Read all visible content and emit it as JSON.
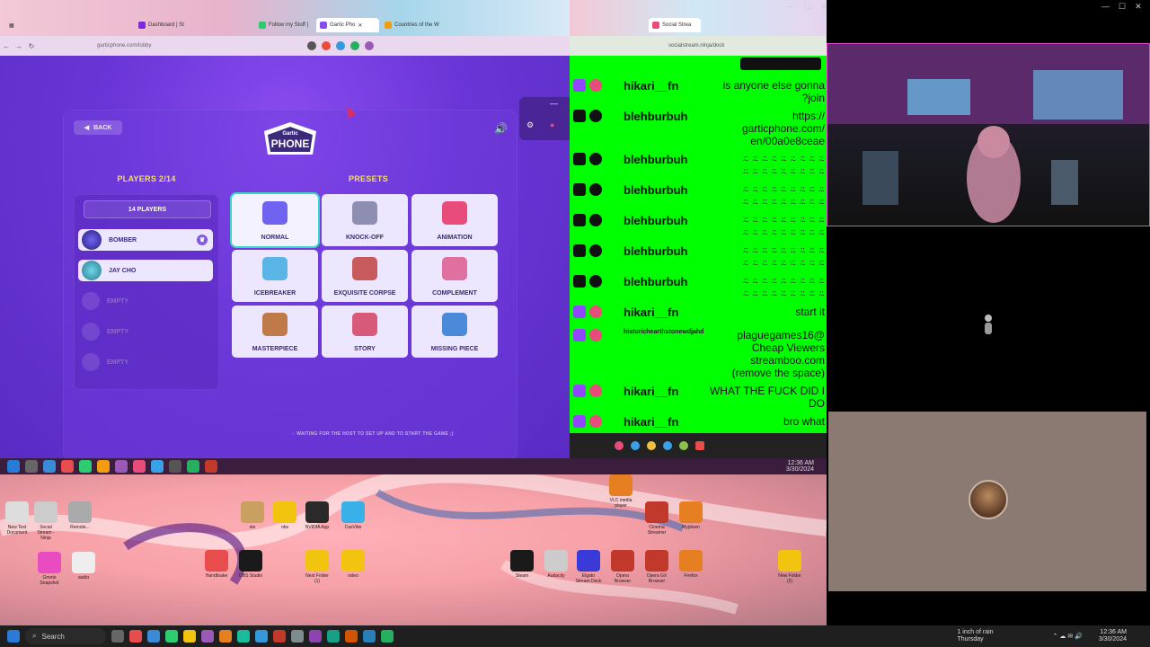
{
  "left_browser": {
    "tabs": [
      "Dashboard | St",
      "Follow my Stuff | ",
      "Gartic Pho",
      "Countries of the W"
    ],
    "url": "garticphone.com/lobby"
  },
  "gartic": {
    "back_label": "BACK",
    "players_title": "PLAYERS 2/14",
    "presets_title": "PRESETS",
    "players_count_label": "14 PLAYERS",
    "players": [
      {
        "name": "BOMBER",
        "filled": true
      },
      {
        "name": "JAY CHO",
        "filled": true
      },
      {
        "name": "EMPTY",
        "filled": false
      },
      {
        "name": "EMPTY",
        "filled": false
      },
      {
        "name": "EMPTY",
        "filled": false
      }
    ],
    "presets": [
      {
        "label": "NORMAL",
        "selected": true
      },
      {
        "label": "KNOCK-OFF",
        "selected": false
      },
      {
        "label": "ANIMATION",
        "selected": false
      },
      {
        "label": "ICEBREAKER",
        "selected": false
      },
      {
        "label": "EXQUISITE CORPSE",
        "selected": false
      },
      {
        "label": "COMPLEMENT",
        "selected": false
      },
      {
        "label": "MASTERPIECE",
        "selected": false
      },
      {
        "label": "STORY",
        "selected": false
      },
      {
        "label": "MISSING PIECE",
        "selected": false
      }
    ],
    "waiting_text": "WAITING FOR THE HOST TO SET UP AND TO START THE GAME ;)"
  },
  "chat_browser": {
    "tab": "Social Strea",
    "url": "socialstream.ninja/dock"
  },
  "chat": [
    {
      "user": "hikari__fn",
      "text": "is anyone else gonna\n?join",
      "platform": "twitch"
    },
    {
      "user": "blehburbuh",
      "text": "https://\ngarticphone.com/\nen/00a0e8ceae",
      "platform": "kick"
    },
    {
      "user": "blehburbuh",
      "text": "⍨ ⍨ ⍨ ⍨ ⍨ ⍨ ⍨ ⍨ ⍨\n⍨ ⍨ ⍨ ⍨ ⍨ ⍨ ⍨ ⍨ ⍨",
      "platform": "kick"
    },
    {
      "user": "blehburbuh",
      "text": "⍨ ⍨ ⍨ ⍨ ⍨ ⍨ ⍨ ⍨ ⍨\n⍨ ⍨ ⍨ ⍨ ⍨ ⍨ ⍨ ⍨ ⍨",
      "platform": "kick"
    },
    {
      "user": "blehburbuh",
      "text": "⍨ ⍨ ⍨ ⍨ ⍨ ⍨ ⍨ ⍨ ⍨\n⍨ ⍨ ⍨ ⍨ ⍨ ⍨ ⍨ ⍨ ⍨",
      "platform": "kick"
    },
    {
      "user": "blehburbuh",
      "text": "⍨ ⍨ ⍨ ⍨ ⍨ ⍨ ⍨ ⍨ ⍨\n⍨ ⍨ ⍨ ⍨ ⍨ ⍨ ⍨ ⍨ ⍨",
      "platform": "kick"
    },
    {
      "user": "blehburbuh",
      "text": "⍨ ⍨ ⍨ ⍨ ⍨ ⍨ ⍨ ⍨ ⍨\n⍨ ⍨ ⍨ ⍨ ⍨ ⍨ ⍨ ⍨ ⍨",
      "platform": "kick"
    },
    {
      "user": "hikari__fn",
      "text": "start it",
      "platform": "twitch"
    },
    {
      "user": "historichearthstonewdjahd",
      "text": "plaguegames16@\nCheap Viewers\nstreamboo.com\n(remove the space)",
      "platform": "twitch"
    },
    {
      "user": "hikari__fn",
      "text": "WHAT THE FUCK DID I\nDO",
      "platform": "twitch"
    },
    {
      "user": "hikari__fn",
      "text": "bro what",
      "platform": "twitch"
    }
  ],
  "inner_taskbar": {
    "time": "12:36 AM",
    "date": "3/30/2024"
  },
  "desktop_icons": [
    "New Text Document",
    "Social Stream - Ninja",
    "Remote...",
    "Gmote Snapshot",
    "audio",
    "ele",
    "obs",
    "NVIDIA App",
    "CasVibe",
    "Handbrake",
    "OBS Studio",
    "Next Folder (1)",
    "video",
    "Steam",
    "Audacity",
    "Elgato Stream Deck",
    "Opera Browser",
    "Opera GX Browser",
    "Firefox",
    "New Folder (2)",
    "VLC media player",
    "Cinema Streamer",
    "Myjdown"
  ],
  "main_taskbar": {
    "search_label": "Search",
    "weather": "1 inch of rain",
    "weather_day": "Thursday",
    "time": "12:36 AM",
    "date": "3/30/2024"
  },
  "colors": {
    "gartic_purple": "#6a35d6",
    "chat_green": "#00ff00",
    "twitch": "#9146ff",
    "kick": "#111111",
    "title_yellow": "#f6df6a",
    "selected_outline": "#3ad7c2"
  }
}
